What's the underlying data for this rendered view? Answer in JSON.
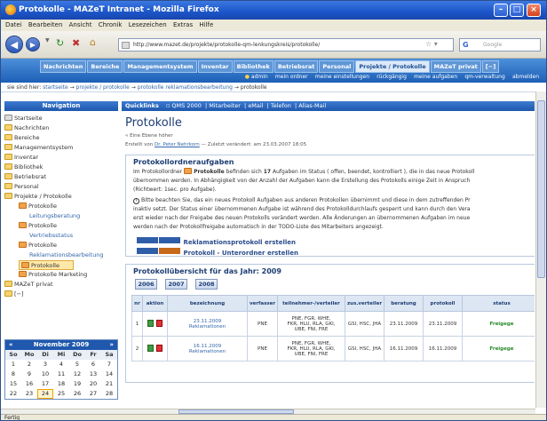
{
  "window": {
    "title": "Protokolle - MAZeT Intranet - Mozilla Firefox"
  },
  "menu": [
    "Datei",
    "Bearbeiten",
    "Ansicht",
    "Chronik",
    "Lesezeichen",
    "Extras",
    "Hilfe"
  ],
  "url": "http://www.mazet.de/projekte/protokolle-qm-lenkungskreis/protokolle/",
  "search_placeholder": "Google",
  "site_nav": [
    "Nachrichten",
    "Bereiche",
    "Managementsystem",
    "Inventar",
    "Bibliothek",
    "Betriebsrat",
    "Personal",
    "Projekte / Protokolle",
    "MAZeT privat",
    "[−]"
  ],
  "sub_nav": [
    "admin",
    "mein ordner",
    "meine einstellungen",
    "rückgängig",
    "meine aufgaben",
    "qm-verwaltung",
    "abmelden"
  ],
  "breadcrumb": {
    "prefix": "sie sind hier:",
    "items": [
      "startseite",
      "projekte / protokolle",
      "protokolle reklamationsbearbeitung",
      "protokolle"
    ]
  },
  "sidebar": {
    "title": "Navigation",
    "items": [
      "Startseite",
      "Nachrichten",
      "Bereiche",
      "Managementsystem",
      "Inventar",
      "Bibliothek",
      "Betriebsrat",
      "Personal",
      "Projekte / Protokolle",
      "Protokolle",
      "Leitungsberatung",
      "Protokolle",
      "Vertriebsstatus",
      "Protokolle",
      "Reklamationsbearbeitung",
      "Protokolle",
      "Protokolle Marketing",
      "MAZeT privat",
      "[−]"
    ]
  },
  "calendar": {
    "month": "November 2009",
    "days": [
      "So",
      "Mo",
      "Di",
      "Mi",
      "Do",
      "Fr",
      "Sa"
    ],
    "weeks": [
      [
        "1",
        "2",
        "3",
        "4",
        "5",
        "6",
        "7"
      ],
      [
        "8",
        "9",
        "10",
        "11",
        "12",
        "13",
        "14"
      ],
      [
        "15",
        "16",
        "17",
        "18",
        "19",
        "20",
        "21"
      ],
      [
        "22",
        "23",
        "24",
        "25",
        "26",
        "27",
        "28"
      ]
    ],
    "today": "24"
  },
  "quicklinks": {
    "label": "Quicklinks",
    "links": [
      "QMS 2000",
      "Mitarbeiter",
      "eMail",
      "Telefon",
      "Alias-Mail"
    ]
  },
  "page_title": "Protokolle",
  "up_link": "« Eine Ebene höher",
  "created": {
    "prefix": "Erstellt von",
    "author": "Dr. Peter Nehrkorn",
    "suffix": "— Zuletzt verändert: am 23.03.2007 18:05"
  },
  "task_panel": {
    "title": "Protokollordneraufgaben",
    "p1_a": "Im Protokollordner",
    "p1_b": "Protokolle",
    "p1_c": "befinden sich",
    "p1_d": "17",
    "p1_e": "Aufgaben im Status ( offen, beendet, kontrolliert ), die in das neue Protokoll",
    "p1_line2": "übernommen werden. In Abhängigkeit von der Anzahl der Aufgaben kann die Erstellung des Protokolls einige Zeit in Anspruch",
    "p1_line3": "(Richtwert: 1sec. pro Aufgabe).",
    "p2_line1": "Bitte beachten Sie, das ein neues Protokoll Aufgaben aus anderen Protokollen übernimmt und diese in dem zutreffenden Pr",
    "p2_line2": "inaktiv setzt. Der Status einer übernommenen Aufgabe ist während des Protokolldurchlaufs gesperrt und kann durch den Vera",
    "p2_line3": "erst wieder nach der Freigabe des neuen Protokolls verändert werden. Alle Änderungen an übernommenen Aufgaben im neue",
    "p2_line4": "werden nach der Protokollfreigabe automatisch in der TODO-Liste des Mitarbeiters angezeigt.",
    "action1": "Reklamationsprotokoll erstellen",
    "action2": "Protokoll - Unterordner erstellen"
  },
  "overview": {
    "title": "Protokollübersicht für das Jahr: 2009",
    "years": [
      "2006",
      "2007",
      "2008"
    ],
    "columns": [
      "nr",
      "aktion",
      "bezeichnung",
      "verfasser",
      "teilnehmer-/verteiler",
      "zus.verteiler",
      "beratung",
      "protokoll",
      "status"
    ],
    "rows": [
      {
        "nr": "1",
        "date": "23.11.2009",
        "name": "Reklamationen",
        "author": "PNE",
        "participants": [
          "PNE, FGR, WHE,",
          "FKR, HLU, RLA, GKI,",
          "UBE, FNI, FRE"
        ],
        "extra": "GSI, HSC, JHA",
        "meeting": "23.11.2009",
        "protocol": "23.11.2009",
        "status": "Freigege"
      },
      {
        "nr": "2",
        "date": "16.11.2009",
        "name": "Reklamationen",
        "author": "PNE",
        "participants": [
          "PNE, FGR, WHE,",
          "FKR, HLU, RLA, GKI,",
          "UBE, FNI, FRE"
        ],
        "extra": "GSI, HSC, JHA",
        "meeting": "16.11.2009",
        "protocol": "16.11.2009",
        "status": "Freigege"
      }
    ]
  },
  "status": "Fertig"
}
